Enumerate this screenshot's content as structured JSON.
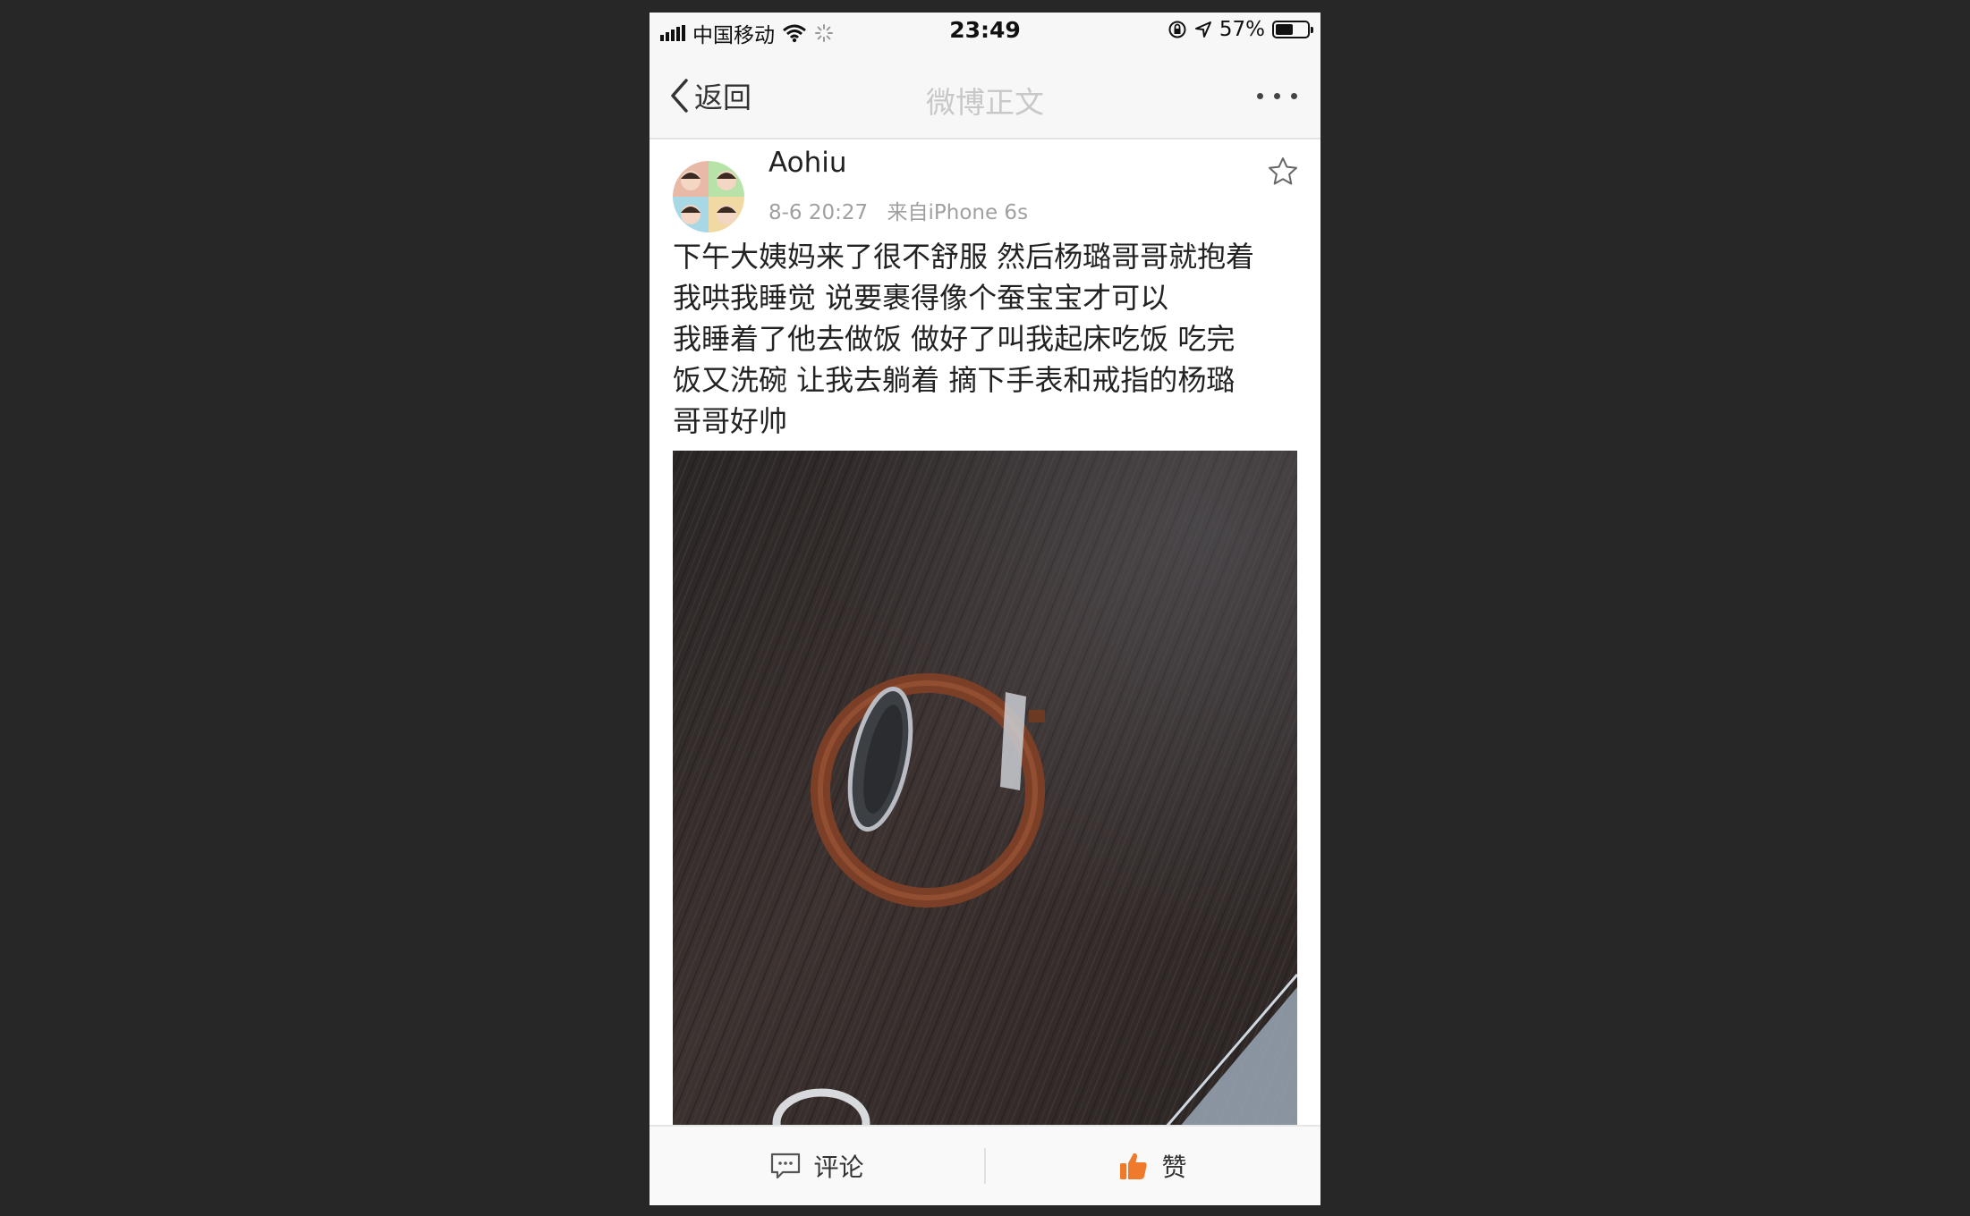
{
  "status_bar": {
    "carrier": "中国移动",
    "time": "23:49",
    "battery_percent": "57%",
    "battery_level": 0.57,
    "icons": [
      "signal-icon",
      "wifi-icon",
      "loading-icon",
      "orientation-lock-icon",
      "location-icon",
      "battery-icon"
    ]
  },
  "nav": {
    "back_label": "返回",
    "title": "微博正文",
    "more_icon": "more-icon"
  },
  "post": {
    "username": "Aohiu",
    "time": "8-6 20:27",
    "source": "来自iPhone 6s",
    "text_lines": [
      "下午大姨妈来了很不舒服 然后杨璐哥哥就抱着",
      "我哄我睡觉 说要裹得像个蚕宝宝才可以",
      "我睡着了他去做饭 做好了叫我起床吃饭 吃完",
      "饭又洗碗 让我去躺着 摘下手表和戒指的杨璐",
      "哥哥好帅"
    ],
    "favorite_icon": "star-icon",
    "photo_subject": "watch-on-table-photo"
  },
  "toolbar": {
    "comment_label": "评论",
    "like_label": "赞",
    "like_color": "#f07a2c"
  }
}
